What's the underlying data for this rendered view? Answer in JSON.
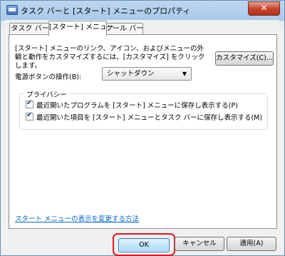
{
  "window": {
    "title": "タスク バーと [スタート] メニューのプロパティ",
    "close": "✕"
  },
  "tabs": [
    {
      "label": "タスク バー"
    },
    {
      "label": "[スタート] メニュー"
    },
    {
      "label": "ツール バー"
    }
  ],
  "start_menu": {
    "description": "[スタート] メニューのリンク、アイコン、およびメニューの外観と動作をカスタマイズするには、[カスタマイズ] をクリックします。",
    "customize_button": "カスタマイズ(C)...",
    "power_button_label": "電源ボタンの操作(B):",
    "power_button_value": "シャットダウン",
    "privacy": {
      "title": "プライバシー",
      "options": [
        {
          "label": "最近開いたプログラムを [スタート] メニューに保存し表示する(P)",
          "checked": true
        },
        {
          "label": "最近開いた項目を [スタート] メニューとタスク バーに保存し表示する(M)",
          "checked": true
        }
      ]
    },
    "link": "スタート メニューの表示を変更する方法"
  },
  "buttons": {
    "ok": "OK",
    "cancel": "キャンセル",
    "apply": "適用(A)"
  },
  "colors": {
    "highlight": "#e0191e",
    "link": "#0066cc"
  }
}
